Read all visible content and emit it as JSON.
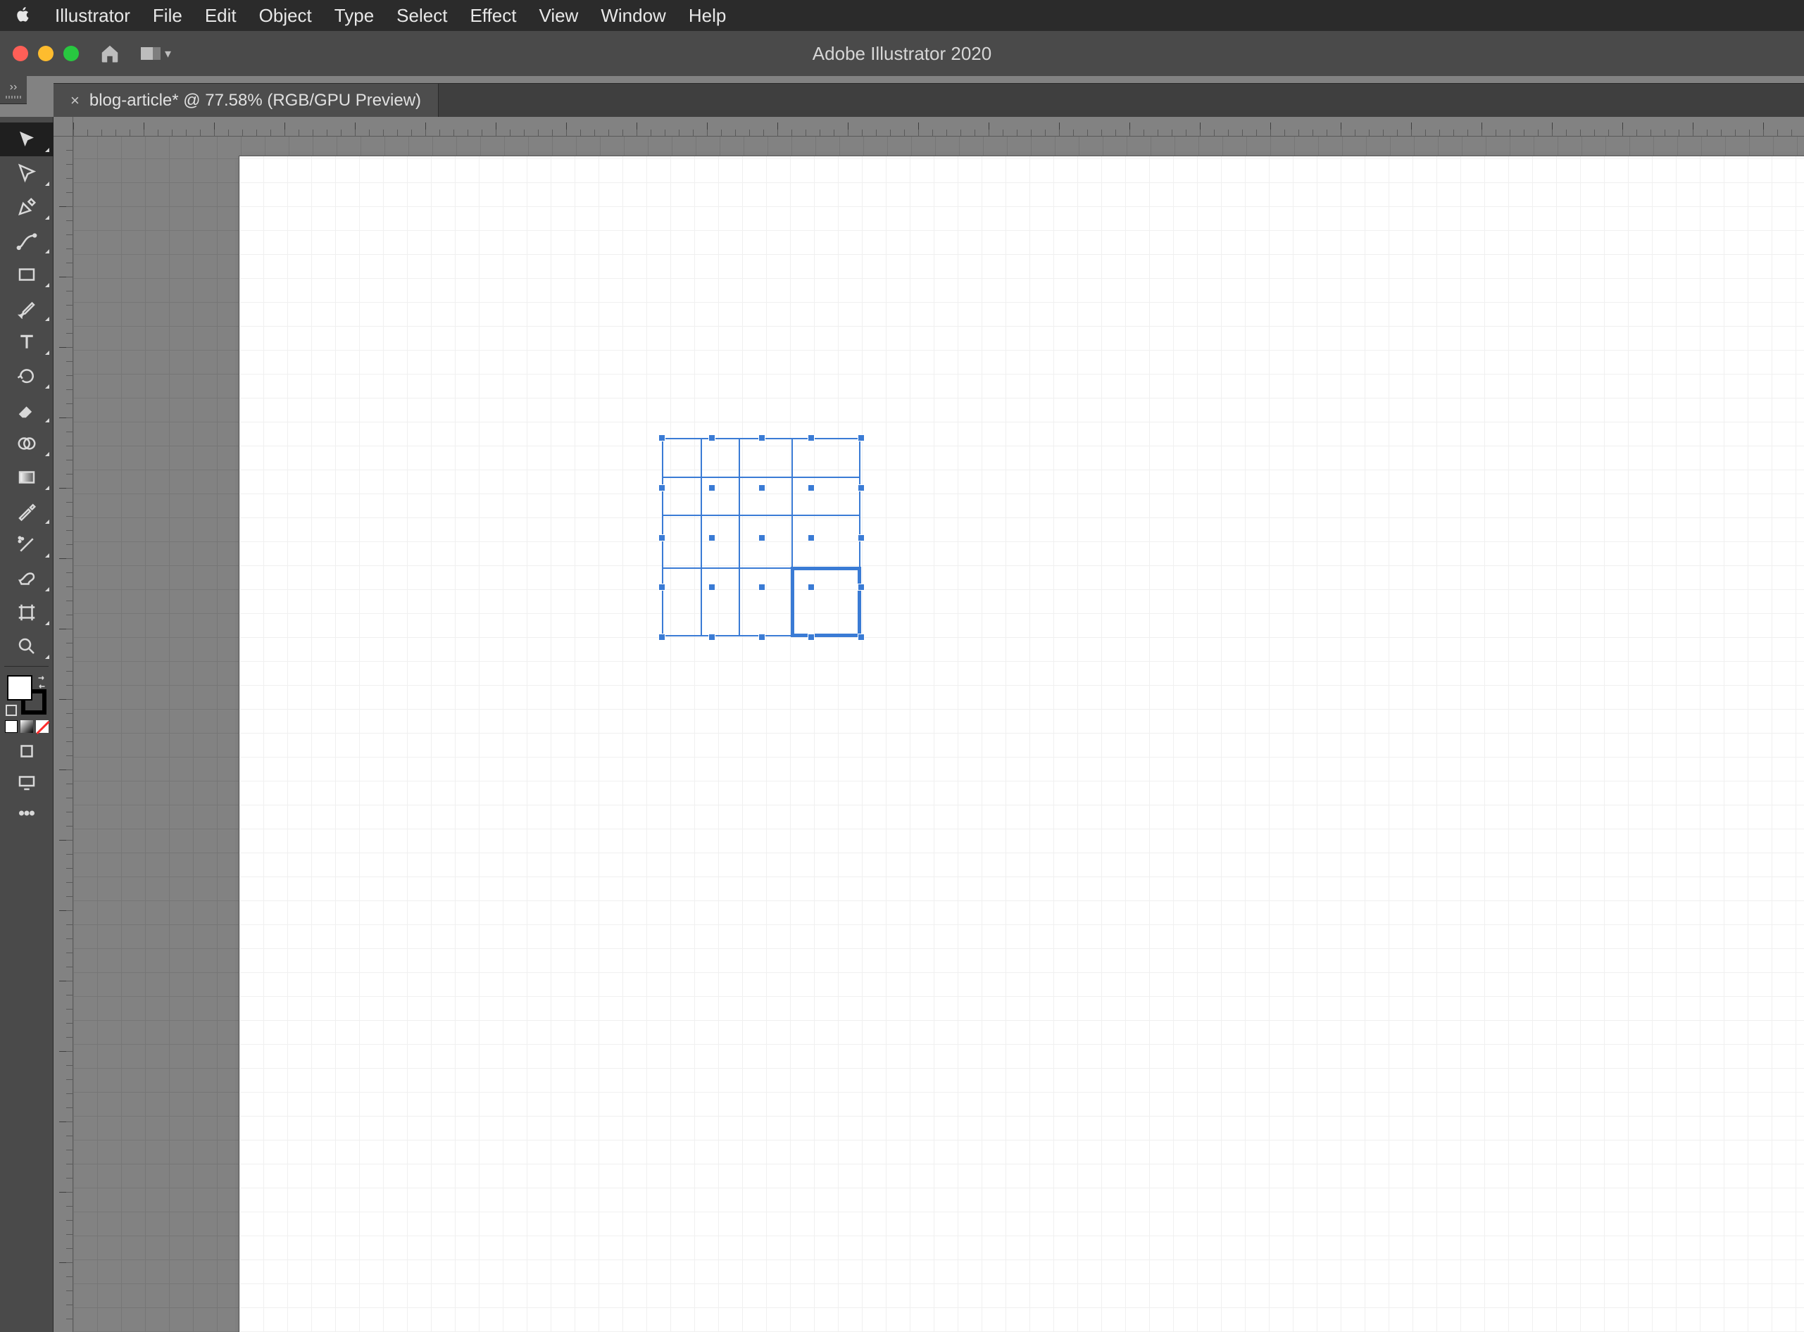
{
  "menubar": {
    "app_name": "Illustrator",
    "items": [
      "File",
      "Edit",
      "Object",
      "Type",
      "Select",
      "Effect",
      "View",
      "Window",
      "Help"
    ]
  },
  "titlebar": {
    "title": "Adobe Illustrator 2020"
  },
  "tab": {
    "label": "blog-article* @ 77.58% (RGB/GPU Preview)"
  },
  "tools": {
    "list": [
      {
        "id": "selection-tool",
        "selected": true
      },
      {
        "id": "direct-selection-tool"
      },
      {
        "id": "pen-tool"
      },
      {
        "id": "curvature-tool"
      },
      {
        "id": "rectangle-tool"
      },
      {
        "id": "paintbrush-tool"
      },
      {
        "id": "type-tool"
      },
      {
        "id": "rotate-tool"
      },
      {
        "id": "eraser-tool"
      },
      {
        "id": "shape-builder-tool"
      },
      {
        "id": "gradient-tool"
      },
      {
        "id": "eyedropper-tool"
      },
      {
        "id": "symbol-sprayer-tool"
      },
      {
        "id": "live-paint-tool"
      },
      {
        "id": "artboard-tool"
      },
      {
        "id": "zoom-tool"
      }
    ]
  },
  "fill_stroke": {
    "fill": "#ffffff",
    "stroke": "#000000"
  },
  "canvas_object": {
    "type": "rectangular-grid",
    "rows": 4,
    "cols": 4,
    "highlighted_cell": [
      3,
      3
    ]
  }
}
